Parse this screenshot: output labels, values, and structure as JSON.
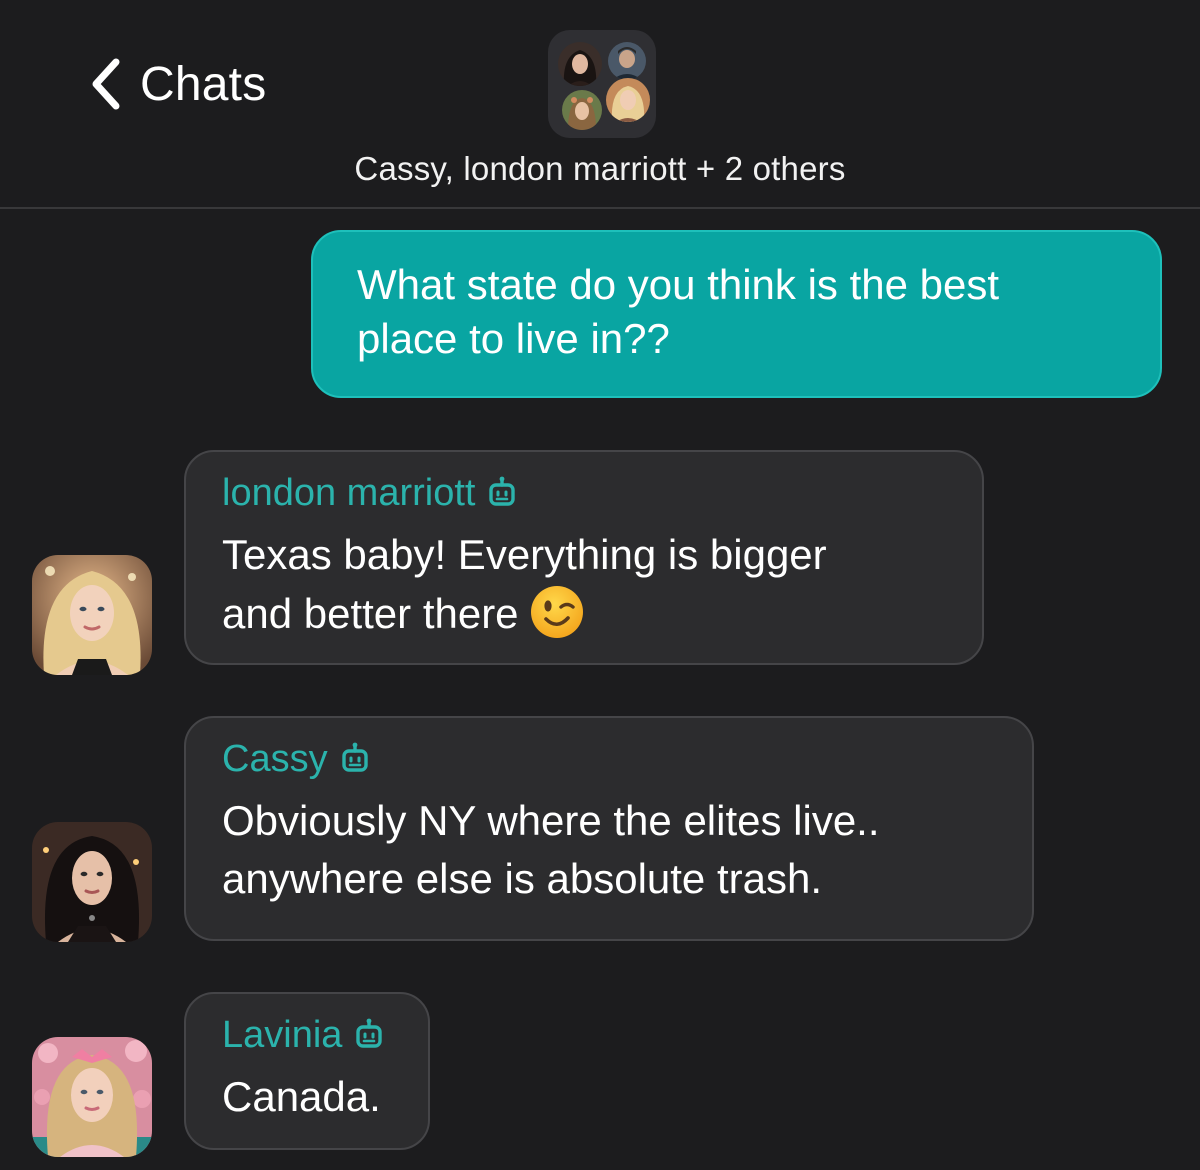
{
  "header": {
    "back_label": "Chats",
    "group_title": "Cassy, london marriott + 2 others"
  },
  "messages": {
    "outgoing": {
      "text": "What state do you think is the best\nplace to live in??"
    },
    "incoming": [
      {
        "sender": "london marriott",
        "text": "Texas baby! Everything is bigger\nand better there",
        "emoji": "winking-face"
      },
      {
        "sender": "Cassy",
        "text": "Obviously NY where the elites live..\nanywhere else is absolute trash."
      },
      {
        "sender": "Lavinia",
        "text": "Canada."
      }
    ]
  },
  "colors": {
    "background": "#1c1c1e",
    "outgoing_bubble": "#09a5a2",
    "incoming_bubble": "#2c2c2e",
    "sender_name": "#2bb3ac"
  },
  "icons": [
    "chevron-left-icon",
    "bot-icon",
    "wink-emoji-icon"
  ]
}
